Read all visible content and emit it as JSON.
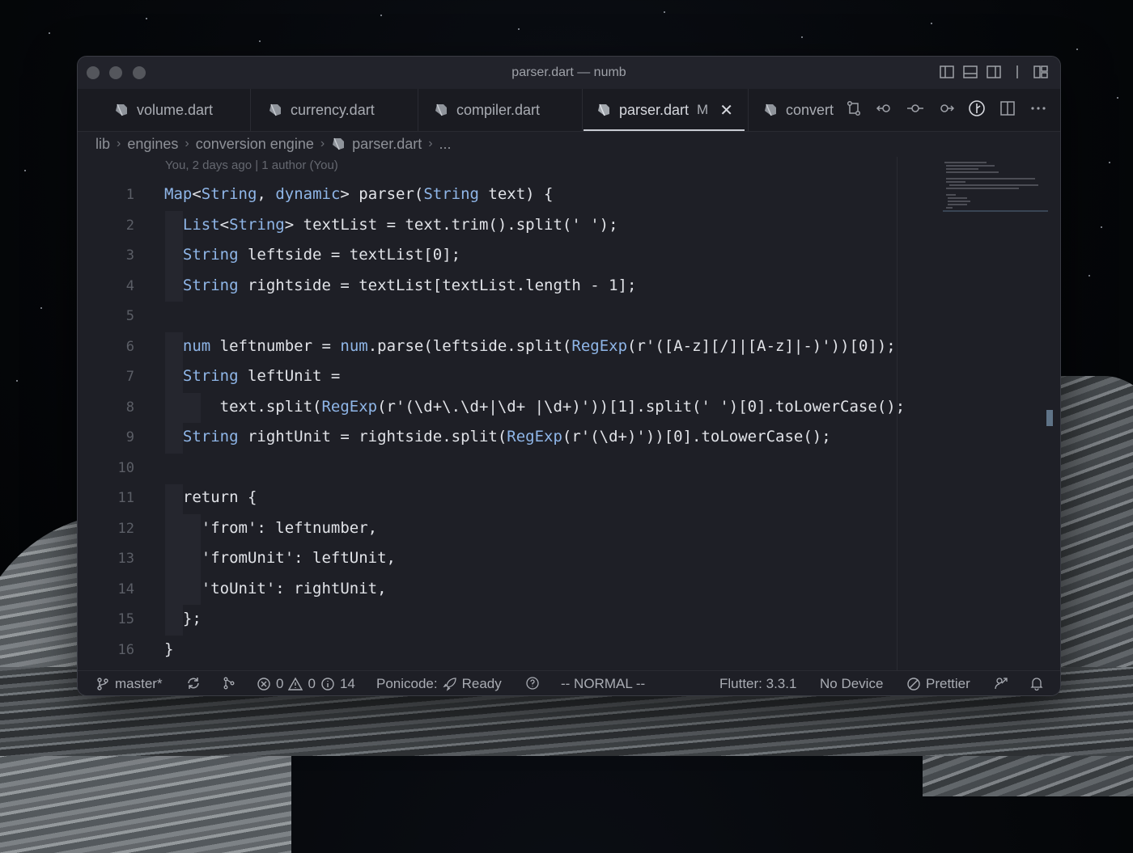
{
  "window": {
    "title": "parser.dart — numb"
  },
  "tabs": [
    {
      "label": "volume.dart",
      "modified": "",
      "active": false
    },
    {
      "label": "currency.dart",
      "modified": "",
      "active": false
    },
    {
      "label": "compiler.dart",
      "modified": "",
      "active": false
    },
    {
      "label": "parser.dart",
      "modified": "M",
      "active": true
    },
    {
      "label": "convert",
      "modified": "",
      "active": false
    }
  ],
  "breadcrumb": [
    "lib",
    "engines",
    "conversion engine",
    "parser.dart",
    "..."
  ],
  "blame": "You, 2 days ago | 1 author (You)",
  "code": {
    "line_numbers": [
      "1",
      "2",
      "3",
      "4",
      "5",
      "6",
      "7",
      "8",
      "9",
      "10",
      "11",
      "12",
      "13",
      "14",
      "15",
      "16"
    ],
    "lines": [
      "Map<String, dynamic> parser(String text) {",
      "  List<String> textList = text.trim().split(' ');",
      "  String leftside = textList[0];",
      "  String rightside = textList[textList.length - 1];",
      "",
      "  num leftnumber = num.parse(leftside.split(RegExp(r'([A-z][/]|[A-z]|-)'))[0]);",
      "  String leftUnit =",
      "      text.split(RegExp(r'(\\d+\\.\\d+|\\d+ |\\d+)'))[1].split(' ')[0].toLowerCase();",
      "  String rightUnit = rightside.split(RegExp(r'(\\d+)'))[0].toLowerCase();",
      "",
      "  return {",
      "    'from': leftnumber,",
      "    'fromUnit': leftUnit,",
      "    'toUnit': rightUnit,",
      "  };",
      "}"
    ]
  },
  "statusbar": {
    "branch": "master*",
    "errors": "0",
    "warnings": "0",
    "infos": "14",
    "ponicode_label": "Ponicode:",
    "ponicode_status": "Ready",
    "vim_mode": "-- NORMAL --",
    "flutter": "Flutter: 3.3.1",
    "device": "No Device",
    "prettier": "Prettier"
  },
  "icons": {
    "tab_file": "dart-file-icon",
    "tab_close": "close-icon"
  },
  "colors": {
    "keyword": "#8fb6e8",
    "text": "#e1e3e8",
    "line_number": "#5b5e66",
    "background": "#1e1f26"
  }
}
